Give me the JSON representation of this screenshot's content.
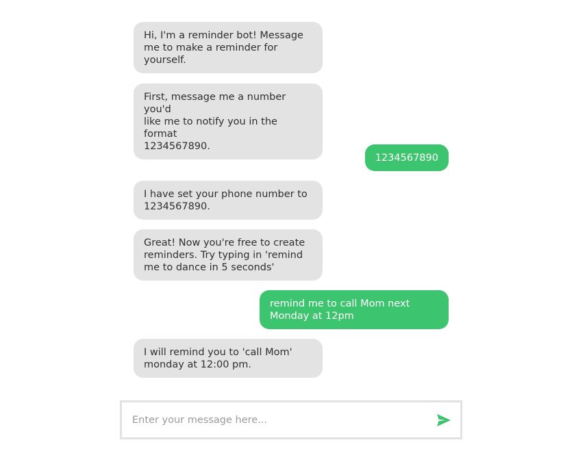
{
  "accent_color": "#3cc46f",
  "bot_bubble_color": "#e3e3e3",
  "messages": [
    {
      "sender": "bot",
      "text": "Hi, I'm a reminder bot! Message\nme to make a reminder for\nyourself."
    },
    {
      "sender": "bot",
      "text": "First, message me a number you'd\nlike me to notify you in the format\n1234567890."
    },
    {
      "sender": "user",
      "text": "1234567890"
    },
    {
      "sender": "bot",
      "text": "I have set your phone number to\n1234567890."
    },
    {
      "sender": "bot",
      "text": "Great! Now you're free to create\nreminders. Try typing in 'remind\nme to dance in 5 seconds'"
    },
    {
      "sender": "user",
      "text": "remind me to call Mom next\nMonday at 12pm"
    },
    {
      "sender": "bot",
      "text": "I will remind you to 'call Mom'\nmonday at 12:00 pm."
    }
  ],
  "composer": {
    "placeholder": "Enter your message here...",
    "value": "",
    "send_icon": "send-icon"
  }
}
